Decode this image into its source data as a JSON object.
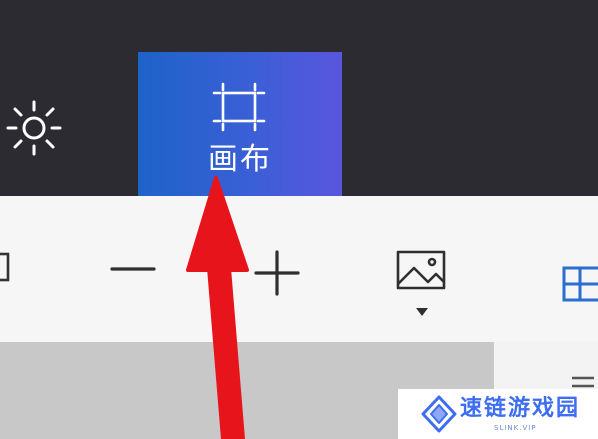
{
  "ribbon": {
    "brightness_icon": "sun-icon",
    "canvas_tab": {
      "label": "画布",
      "icon": "canvas-crop-icon",
      "selected": true,
      "gradient": [
        "#1e63c8",
        "#5a56de"
      ]
    }
  },
  "toolbar": {
    "zoom_out_icon": "minus-icon",
    "zoom_in_icon": "plus-icon",
    "image_icon": "image-dropdown-icon",
    "right_icon": "canvas-crop-icon"
  },
  "annotation": {
    "arrow_color": "#e8141b"
  },
  "watermark": {
    "title": "速链游戏园",
    "subtitle": "SLINK.VIP",
    "color": "#3d6df2"
  },
  "colors": {
    "topbar": "#2c2b31",
    "toolbar": "#f6f6f6",
    "canvas_surface": "#c8c8c8"
  }
}
